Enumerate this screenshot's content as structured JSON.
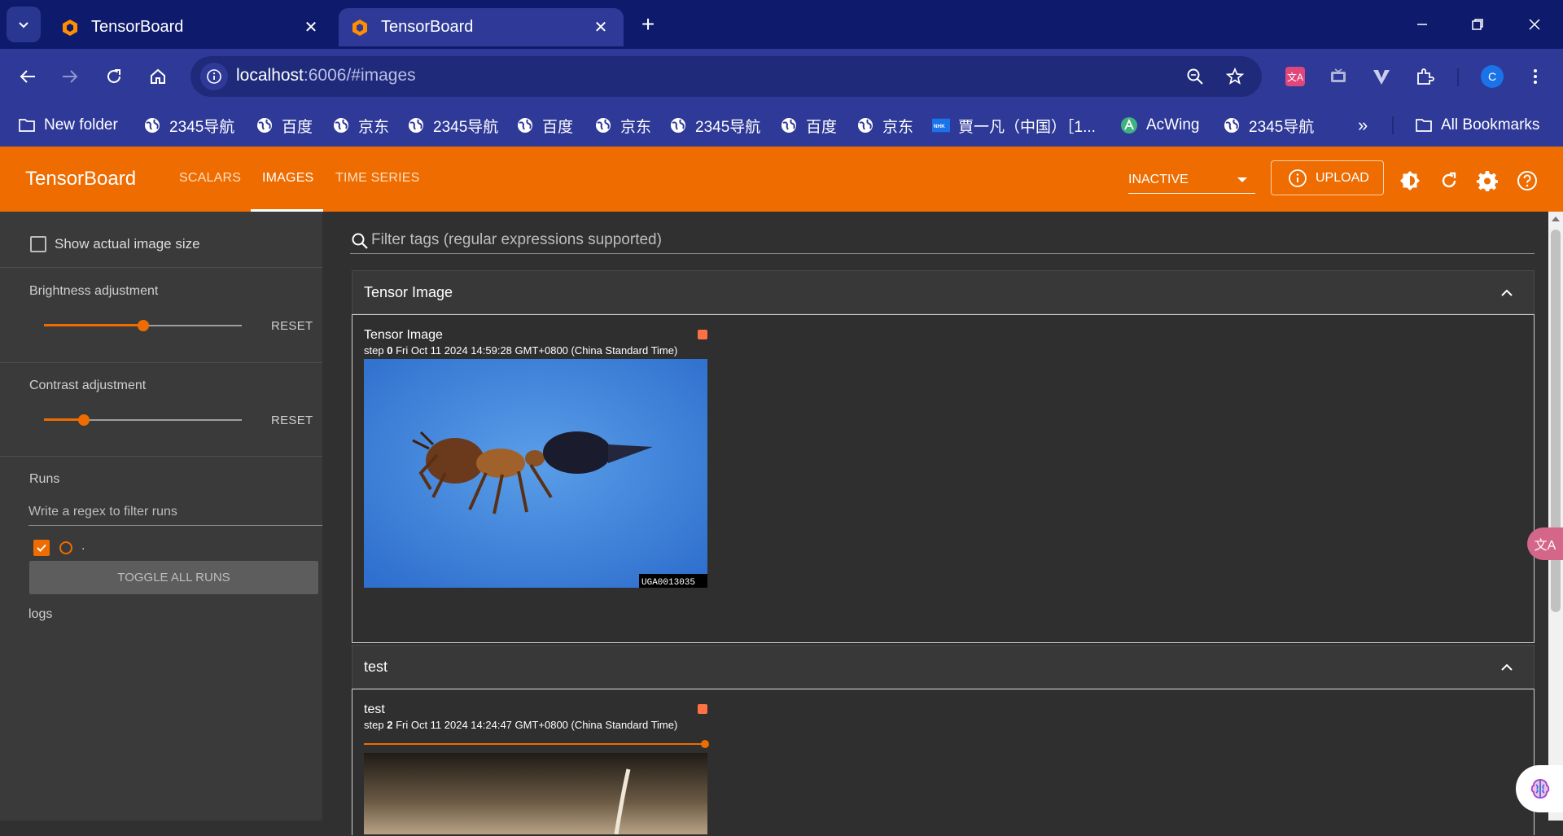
{
  "browser": {
    "tabs": [
      {
        "title": "TensorBoard",
        "close": "✕"
      },
      {
        "title": "TensorBoard",
        "close": "✕"
      }
    ],
    "new_tab": "+",
    "url_host": "localhost",
    "url_rest": ":6006/#images",
    "profile_initial": "C",
    "bookmarks": [
      {
        "label": "New folder",
        "icon": "folder-icon"
      },
      {
        "label": "2345导航",
        "icon": "globe-icon"
      },
      {
        "label": "百度",
        "icon": "globe-icon"
      },
      {
        "label": "京东",
        "icon": "globe-icon"
      },
      {
        "label": "2345导航",
        "icon": "globe-icon"
      },
      {
        "label": "百度",
        "icon": "globe-icon"
      },
      {
        "label": "京东",
        "icon": "globe-icon"
      },
      {
        "label": "2345导航",
        "icon": "globe-icon"
      },
      {
        "label": "百度",
        "icon": "globe-icon"
      },
      {
        "label": "京东",
        "icon": "globe-icon"
      },
      {
        "label": "賈一凡（中国）［1...",
        "icon": "nhk-icon"
      },
      {
        "label": "AcWing",
        "icon": "acwing-icon"
      },
      {
        "label": "2345导航",
        "icon": "globe-icon"
      }
    ],
    "bookmarks_overflow": "»",
    "all_bookmarks": "All Bookmarks"
  },
  "tensorboard": {
    "brand": "TensorBoard",
    "nav": [
      "SCALARS",
      "IMAGES",
      "TIME SERIES"
    ],
    "active_nav": "IMAGES",
    "run_selector": "INACTIVE",
    "upload": "UPLOAD",
    "colors": {
      "header": "#ef6c00",
      "accent": "#ef6c00",
      "panel": "#3a3a3a",
      "main": "#303030"
    }
  },
  "sidebar": {
    "show_actual_size": "Show actual image size",
    "brightness_label": "Brightness adjustment",
    "brightness_level": 0.5,
    "contrast_label": "Contrast adjustment",
    "contrast_level": 0.2,
    "reset": "RESET",
    "runs_label": "Runs",
    "regex_placeholder": "Write a regex to filter runs",
    "run_name": ".",
    "toggle_all": "TOGGLE ALL RUNS",
    "logs": "logs"
  },
  "main": {
    "filter_placeholder": "Filter tags (regular expressions supported)",
    "groups": [
      {
        "title": "Tensor Image",
        "card": {
          "title": "Tensor Image",
          "step_label": "step",
          "step": "0",
          "time": "Fri Oct 11 2024 14:59:28 GMT+0800 (China Standard Time)",
          "image_caption": "UGA0013035"
        }
      },
      {
        "title": "test",
        "card": {
          "title": "test",
          "step_label": "step",
          "step": "2",
          "time": "Fri Oct 11 2024 14:24:47 GMT+0800 (China Standard Time)"
        }
      }
    ]
  },
  "floater_text": "文A"
}
